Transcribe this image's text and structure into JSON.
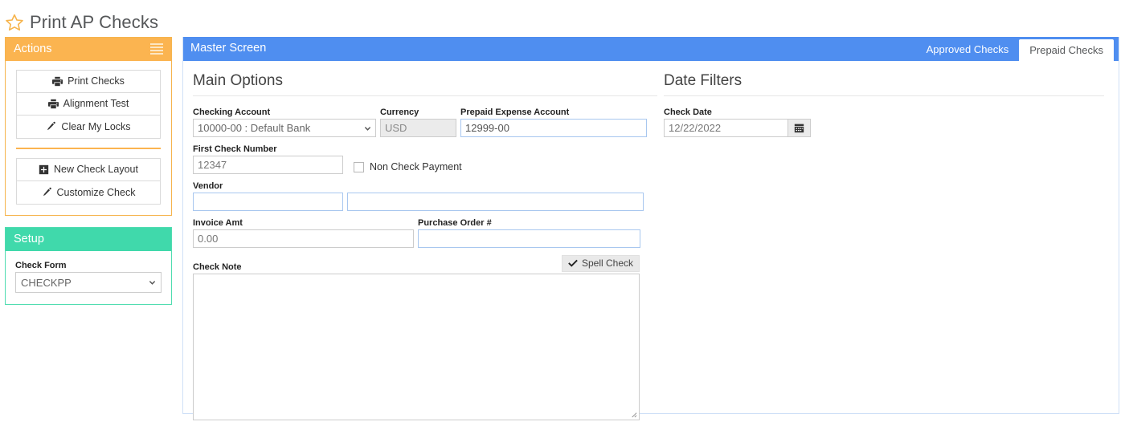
{
  "page": {
    "title": "Print AP Checks",
    "favorite_icon": "star-icon"
  },
  "sidebar": {
    "actions": {
      "header": "Actions",
      "menu_icon": "hamburger-icon",
      "group1": [
        {
          "label": "Print Checks",
          "icon": "printer-icon"
        },
        {
          "label": "Alignment Test",
          "icon": "printer-icon"
        },
        {
          "label": "Clear My Locks",
          "icon": "pencil-icon"
        }
      ],
      "group2": [
        {
          "label": "New Check Layout",
          "icon": "plus-square-icon"
        },
        {
          "label": "Customize Check",
          "icon": "pencil-icon"
        }
      ]
    },
    "setup": {
      "header": "Setup",
      "check_form_label": "Check Form",
      "check_form_value": "CHECKPP",
      "check_form_options": [
        "CHECKPP"
      ]
    }
  },
  "master": {
    "title": "Master Screen",
    "tabs": [
      {
        "label": "Approved Checks",
        "active": false
      },
      {
        "label": "Prepaid Checks",
        "active": true
      }
    ]
  },
  "main_options": {
    "title": "Main Options",
    "checking_account": {
      "label": "Checking Account",
      "value": "10000-00 : Default Bank",
      "options": [
        "10000-00 : Default Bank"
      ]
    },
    "currency": {
      "label": "Currency",
      "value": "USD"
    },
    "prepaid_expense_account": {
      "label": "Prepaid Expense Account",
      "value": "12999-00"
    },
    "first_check_number": {
      "label": "First Check Number",
      "value": "12347"
    },
    "non_check_payment": {
      "label": "Non Check Payment",
      "checked": false
    },
    "vendor": {
      "label": "Vendor",
      "code_value": "",
      "name_value": ""
    },
    "invoice_amt": {
      "label": "Invoice Amt",
      "value": "0.00"
    },
    "purchase_order": {
      "label": "Purchase Order #",
      "value": ""
    },
    "check_note": {
      "label": "Check Note",
      "value": ""
    },
    "spell_check": {
      "label": "Spell Check",
      "icon": "check-icon"
    }
  },
  "date_filters": {
    "title": "Date Filters",
    "check_date": {
      "label": "Check Date",
      "value": "12/22/2022",
      "icon": "calendar-icon"
    }
  },
  "colors": {
    "actions_header": "#fbb450",
    "setup_header": "#40d9ab",
    "master_header": "#4f8ef0",
    "star": "#f6b44d",
    "panel_border": "#cfe0f7"
  }
}
